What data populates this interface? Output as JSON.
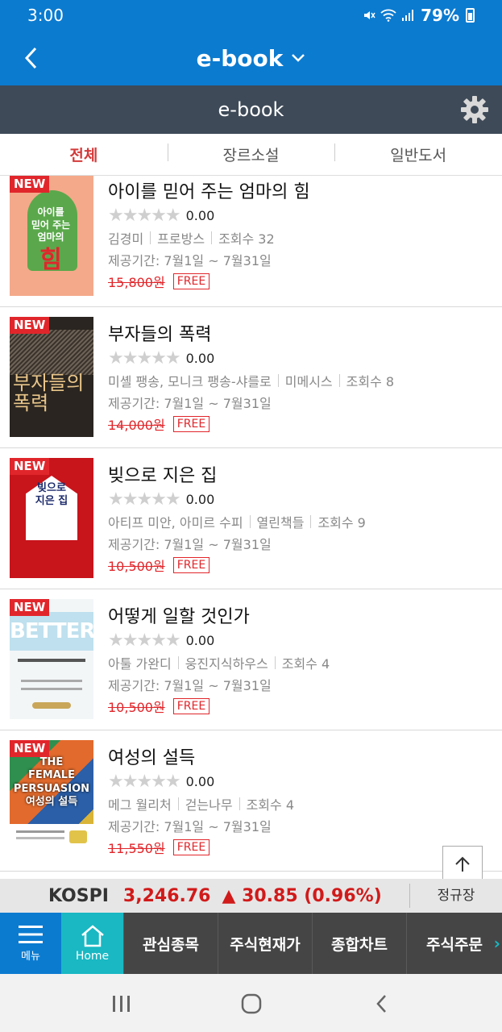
{
  "status_bar": {
    "time": "3:00",
    "battery": "79%",
    "icons": [
      "mute-icon",
      "wifi-icon",
      "signal-icon",
      "battery-icon"
    ]
  },
  "header": {
    "title": "e-book",
    "back_icon": "chevron-left-icon",
    "dropdown_icon": "chevron-down-icon"
  },
  "sub_header": {
    "title": "e-book",
    "settings_icon": "gear-icon"
  },
  "tabs": [
    {
      "label": "전체",
      "active": true
    },
    {
      "label": "장르소설",
      "active": false
    },
    {
      "label": "일반도서",
      "active": false
    }
  ],
  "books": [
    {
      "badge": "NEW",
      "cover_text": "아이를 믿어 주는 엄마의 힘",
      "title": "아이를 믿어 주는 엄마의 힘",
      "rating": "0.00",
      "author": "김경미",
      "publisher": "프로방스",
      "views": "조회수 32",
      "period": "제공기간: 7월1일 ~ 7월31일",
      "price": "15,800원",
      "free": "FREE"
    },
    {
      "badge": "NEW",
      "cover_text": "부자들의 폭력",
      "title": "부자들의 폭력",
      "rating": "0.00",
      "author": "미셸 팽송, 모니크 팽송-샤를로",
      "publisher": "미메시스",
      "views": "조회수 8",
      "period": "제공기간: 7월1일 ~ 7월31일",
      "price": "14,000원",
      "free": "FREE"
    },
    {
      "badge": "NEW",
      "cover_text": "빚으로 지은 집",
      "title": "빚으로 지은 집",
      "rating": "0.00",
      "author": "아티프 미안, 아미르 수피",
      "publisher": "열린책들",
      "views": "조회수 9",
      "period": "제공기간: 7월1일 ~ 7월31일",
      "price": "10,500원",
      "free": "FREE"
    },
    {
      "badge": "NEW",
      "cover_text": "BETTER",
      "title": "어떻게 일할 것인가",
      "rating": "0.00",
      "author": "아툴 가완디",
      "publisher": "웅진지식하우스",
      "views": "조회수 4",
      "period": "제공기간: 7월1일 ~ 7월31일",
      "price": "10,500원",
      "free": "FREE"
    },
    {
      "badge": "NEW",
      "cover_text": "THE FEMALE PERSUASION 여성의 설득",
      "title": "여성의 설득",
      "rating": "0.00",
      "author": "메그 월리처",
      "publisher": "걷는나무",
      "views": "조회수 4",
      "period": "제공기간: 7월1일 ~ 7월31일",
      "price": "11,550원",
      "free": "FREE"
    }
  ],
  "ticker": {
    "name": "KOSPI",
    "value": "3,246.76",
    "change": "▲ 30.85 (0.96%)",
    "status": "정규장"
  },
  "bottom_nav": {
    "menu_label": "메뉴",
    "home_label": "Home",
    "items": [
      "관심종목",
      "주식현재가",
      "종합차트",
      "주식주문"
    ]
  },
  "colors": {
    "primary": "#0b7bd0",
    "sub_header": "#3e4a58",
    "accent_red": "#e1262b",
    "home_teal": "#19b8c3"
  }
}
